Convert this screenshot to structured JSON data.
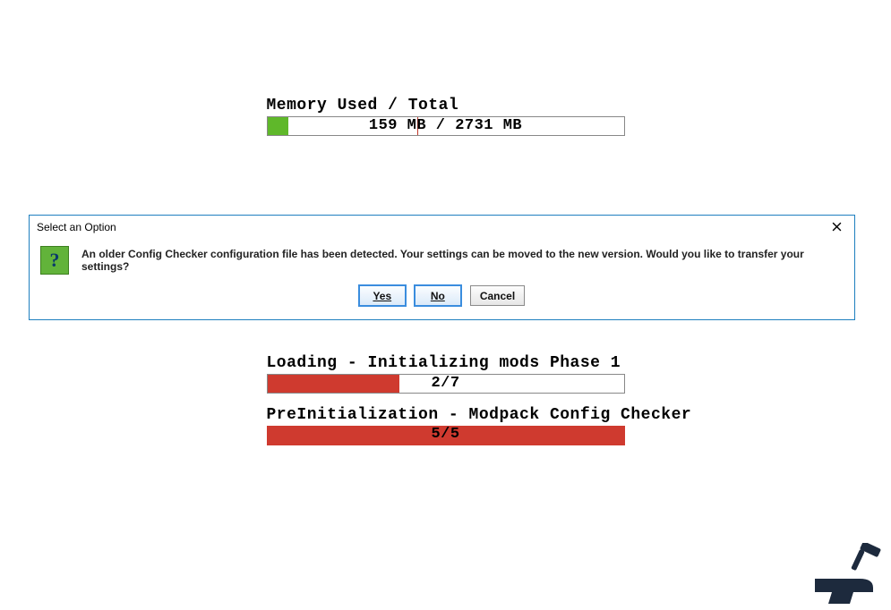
{
  "memory": {
    "label": "Memory Used / Total",
    "text": "159 MB / 2731 MB",
    "used_mb": 159,
    "total_mb": 2731,
    "fill_percent": 5.8,
    "tick_percent": 42
  },
  "dialog": {
    "title": "Select an Option",
    "icon_glyph": "?",
    "message": "An older Config Checker configuration file has been detected. Your settings can be moved to the new version. Would you like to transfer your settings?",
    "buttons": {
      "yes": "Yes",
      "no": "No",
      "cancel": "Cancel"
    }
  },
  "progress": {
    "loading": {
      "label": "Loading - Initializing mods Phase 1",
      "count_text": "2/7",
      "current": 2,
      "total": 7,
      "fill_percent": 37
    },
    "preinit": {
      "label": "PreInitialization - Modpack Config Checker",
      "count_text": "5/5",
      "current": 5,
      "total": 5,
      "fill_percent": 100
    }
  },
  "colors": {
    "green_fill": "#5fb82a",
    "red_fill": "#cf3a2f",
    "dialog_border": "#1e7fbf"
  }
}
